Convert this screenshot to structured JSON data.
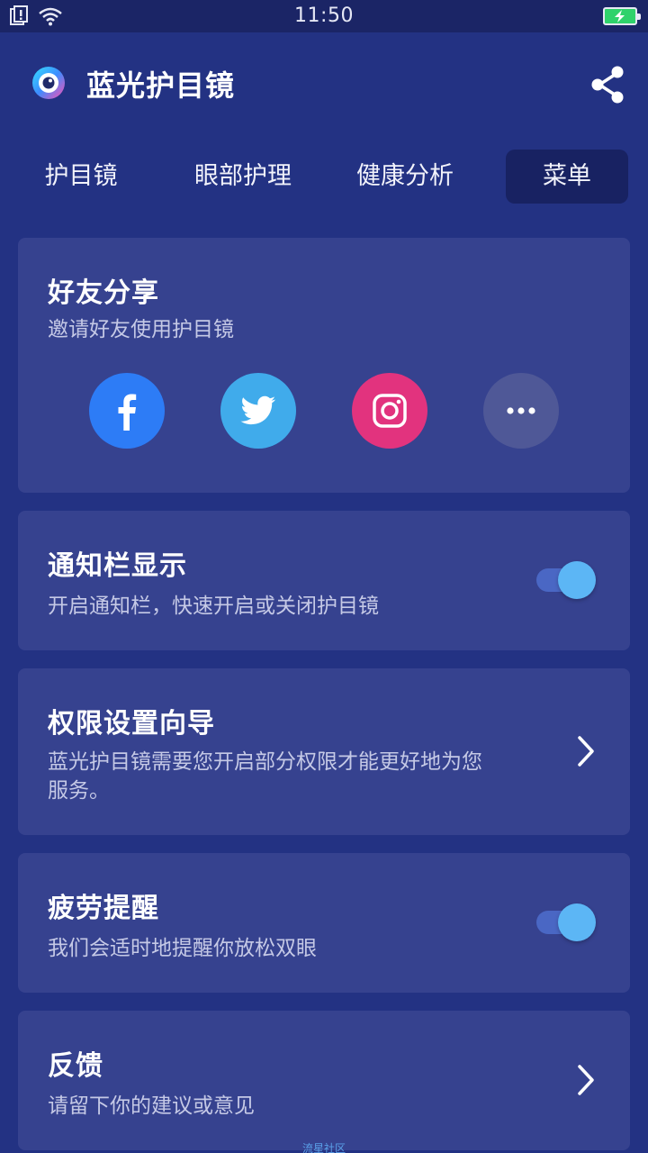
{
  "status_bar": {
    "time": "11:50",
    "icons": [
      "notification-alert-icon",
      "wifi-icon",
      "battery-charging-icon"
    ]
  },
  "header": {
    "app_title": "蓝光护目镜",
    "logo_icon": "eye-logo-icon",
    "share_icon": "share-icon"
  },
  "tabs": [
    {
      "label": "护目镜",
      "active": false
    },
    {
      "label": "眼部护理",
      "active": false
    },
    {
      "label": "健康分析",
      "active": false
    },
    {
      "label": "菜单",
      "active": true
    }
  ],
  "share_card": {
    "title": "好友分享",
    "description": "邀请好友使用护目镜",
    "buttons": [
      {
        "icon": "facebook-icon",
        "color": "#2d7cf6"
      },
      {
        "icon": "twitter-icon",
        "color": "#40abeb"
      },
      {
        "icon": "instagram-icon",
        "color": "#e2337e"
      },
      {
        "icon": "more-icon",
        "color": "#4f5897"
      }
    ]
  },
  "notification_card": {
    "title": "通知栏显示",
    "description": "开启通知栏，快速开启或关闭护目镜",
    "toggle_on": true
  },
  "permission_card": {
    "title": "权限设置向导",
    "description_line1": "蓝光护目镜需要您开启部分权限才能更好地为您",
    "description_line2": "服务。"
  },
  "fatigue_card": {
    "title": "疲劳提醒",
    "description": "我们会适时地提醒你放松双眼",
    "toggle_on": true
  },
  "feedback_card": {
    "title": "反馈",
    "description": "请留下你的建议或意见"
  },
  "watermark": "流星社区",
  "colors": {
    "background": "#233283",
    "card": "#36428f",
    "active_tab": "#182262",
    "toggle_knob": "#5cb6f5"
  }
}
